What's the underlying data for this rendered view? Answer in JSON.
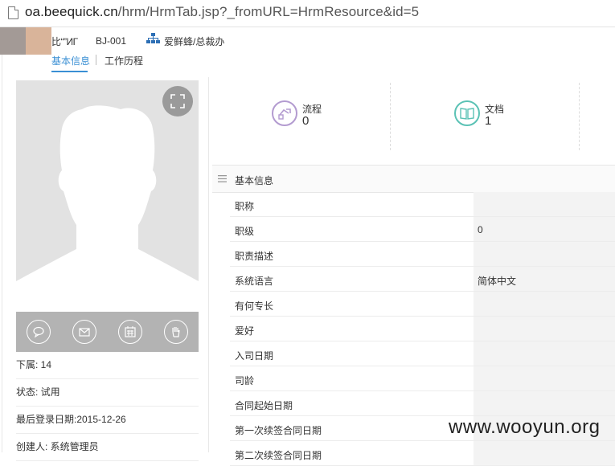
{
  "browser": {
    "url_host": "oa.beequick.cn",
    "url_path": "/hrm/HrmTab.jsp?_fromURL=HrmResource&id=5"
  },
  "header": {
    "employee_name": "比“”ИГ",
    "employee_code": "BJ-001",
    "org_path": "爱鲜蜂/总裁办"
  },
  "tabs": [
    {
      "label": "基本信息"
    },
    {
      "label": "工作历程"
    }
  ],
  "profile": {
    "info_rows": [
      {
        "text": "下属: 14"
      },
      {
        "text": "状态: 试用"
      },
      {
        "text": "最后登录日期:2015-12-26"
      },
      {
        "text": "创建人: 系统管理员"
      }
    ],
    "action_icons": [
      "message-icon",
      "email-icon",
      "calendar-icon",
      "hand-icon"
    ]
  },
  "stats": [
    {
      "label": "流程",
      "count": "0",
      "color": "#b39bd0",
      "icon": "workflow-icon"
    },
    {
      "label": "文档",
      "count": "1",
      "color": "#5bc2b5",
      "icon": "book-icon"
    }
  ],
  "section": {
    "title": "基本信息",
    "fields": [
      {
        "label": "职称",
        "value": ""
      },
      {
        "label": "职级",
        "value": "0"
      },
      {
        "label": "职责描述",
        "value": ""
      },
      {
        "label": "系统语言",
        "value": "简体中文"
      },
      {
        "label": "有何专长",
        "value": ""
      },
      {
        "label": "爱好",
        "value": ""
      },
      {
        "label": "入司日期",
        "value": ""
      },
      {
        "label": "司龄",
        "value": ""
      },
      {
        "label": "合同起始日期",
        "value": ""
      },
      {
        "label": "第一次续签合同日期",
        "value": ""
      },
      {
        "label": "第二次续签合同日期",
        "value": ""
      }
    ]
  },
  "watermark": "www.wooyun.org",
  "colors": {
    "accent": "#3a8fd4",
    "workflow": "#b39bd0",
    "document": "#5bc2b5"
  }
}
